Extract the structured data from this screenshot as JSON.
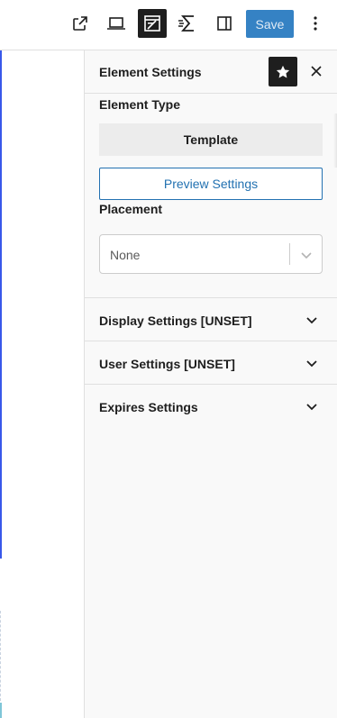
{
  "toolbar": {
    "icons": [
      "external-link-icon",
      "desktop-preview-icon",
      "block-layout-icon",
      "sigma-tool-icon",
      "sidebar-toggle-icon",
      "more-vertical-icon"
    ],
    "save_label": "Save",
    "save_color": "#3582c4"
  },
  "panel": {
    "title": "Element Settings",
    "element_type_label": "Element Type",
    "element_type_value": "Template",
    "preview_button_label": "Preview Settings",
    "placement_label": "Placement",
    "placement_value": "None",
    "sections": [
      {
        "label": "Display Settings [UNSET]"
      },
      {
        "label": "User Settings [UNSET]"
      },
      {
        "label": "Expires Settings"
      }
    ]
  },
  "colors": {
    "accent": "#2271b1",
    "canvas_highlight": "#3858e9",
    "dark_button": "#1e1e1e"
  }
}
